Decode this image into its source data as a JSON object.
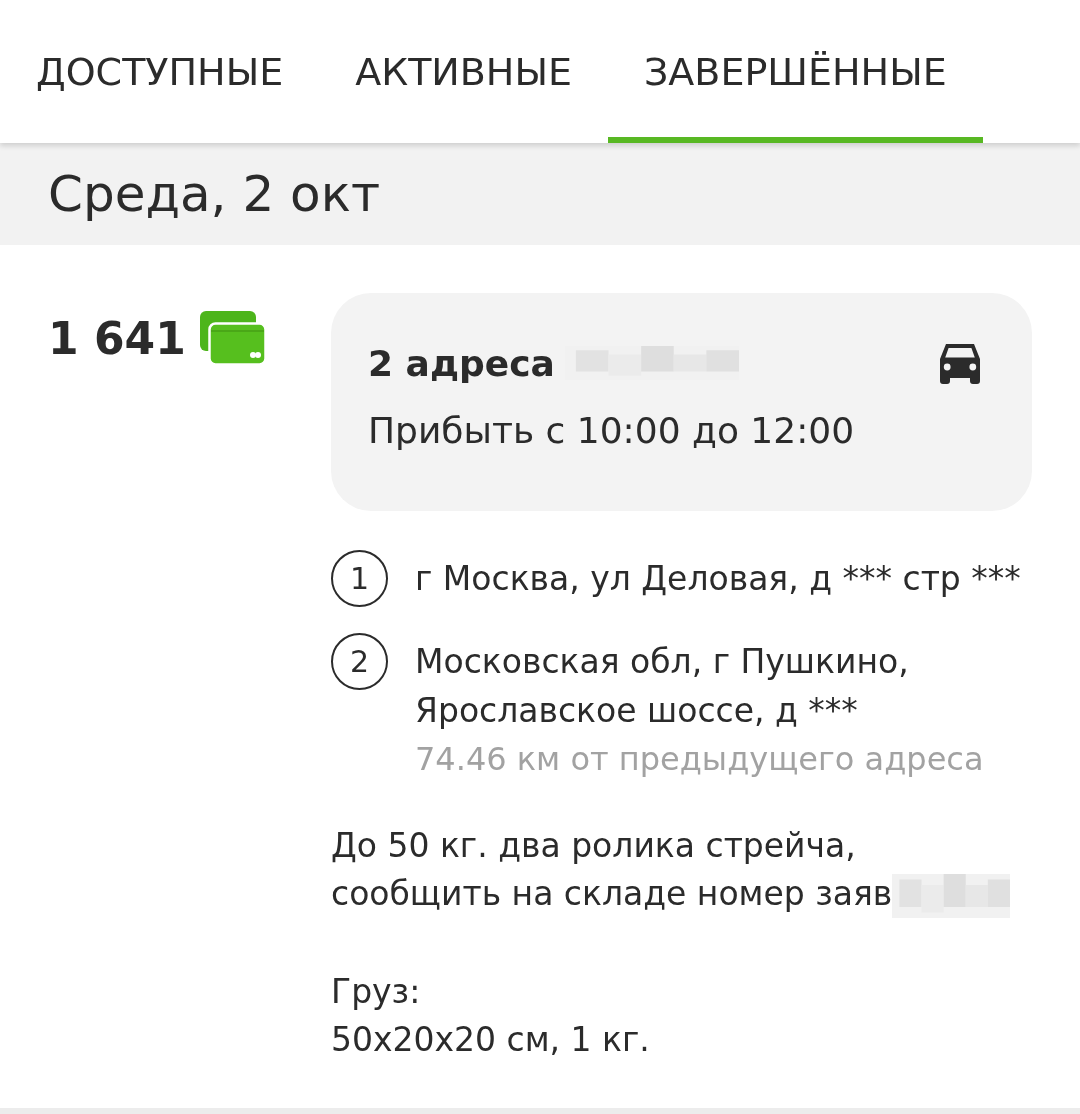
{
  "tabs": [
    {
      "label": "ДОСТУПНЫЕ",
      "selected": false
    },
    {
      "label": "АКТИВНЫЕ",
      "selected": false
    },
    {
      "label": "ЗАВЕРШЁННЫЕ",
      "selected": true
    }
  ],
  "date_header": "Среда, 2 окт",
  "order": {
    "price": "1 641",
    "summary": {
      "title": "2 адреса",
      "title_redacted": true,
      "time_window": "Прибыть с 10:00 до 12:00"
    },
    "addresses": [
      {
        "number": "1",
        "text": "г Москва, ул Деловая, д *** стр ***"
      },
      {
        "number": "2",
        "text": "Московская обл, г Пушкино, Ярославское шоссе, д ***",
        "distance": "74.46 км от предыдущего адреса"
      }
    ],
    "note": {
      "text": "До 50 кг. два ролика стрейча,\nсообщить на складе номер заяв",
      "redacted": true
    },
    "cargo": {
      "label": "Груз:",
      "value": "50x20x20 см, 1 кг."
    }
  }
}
